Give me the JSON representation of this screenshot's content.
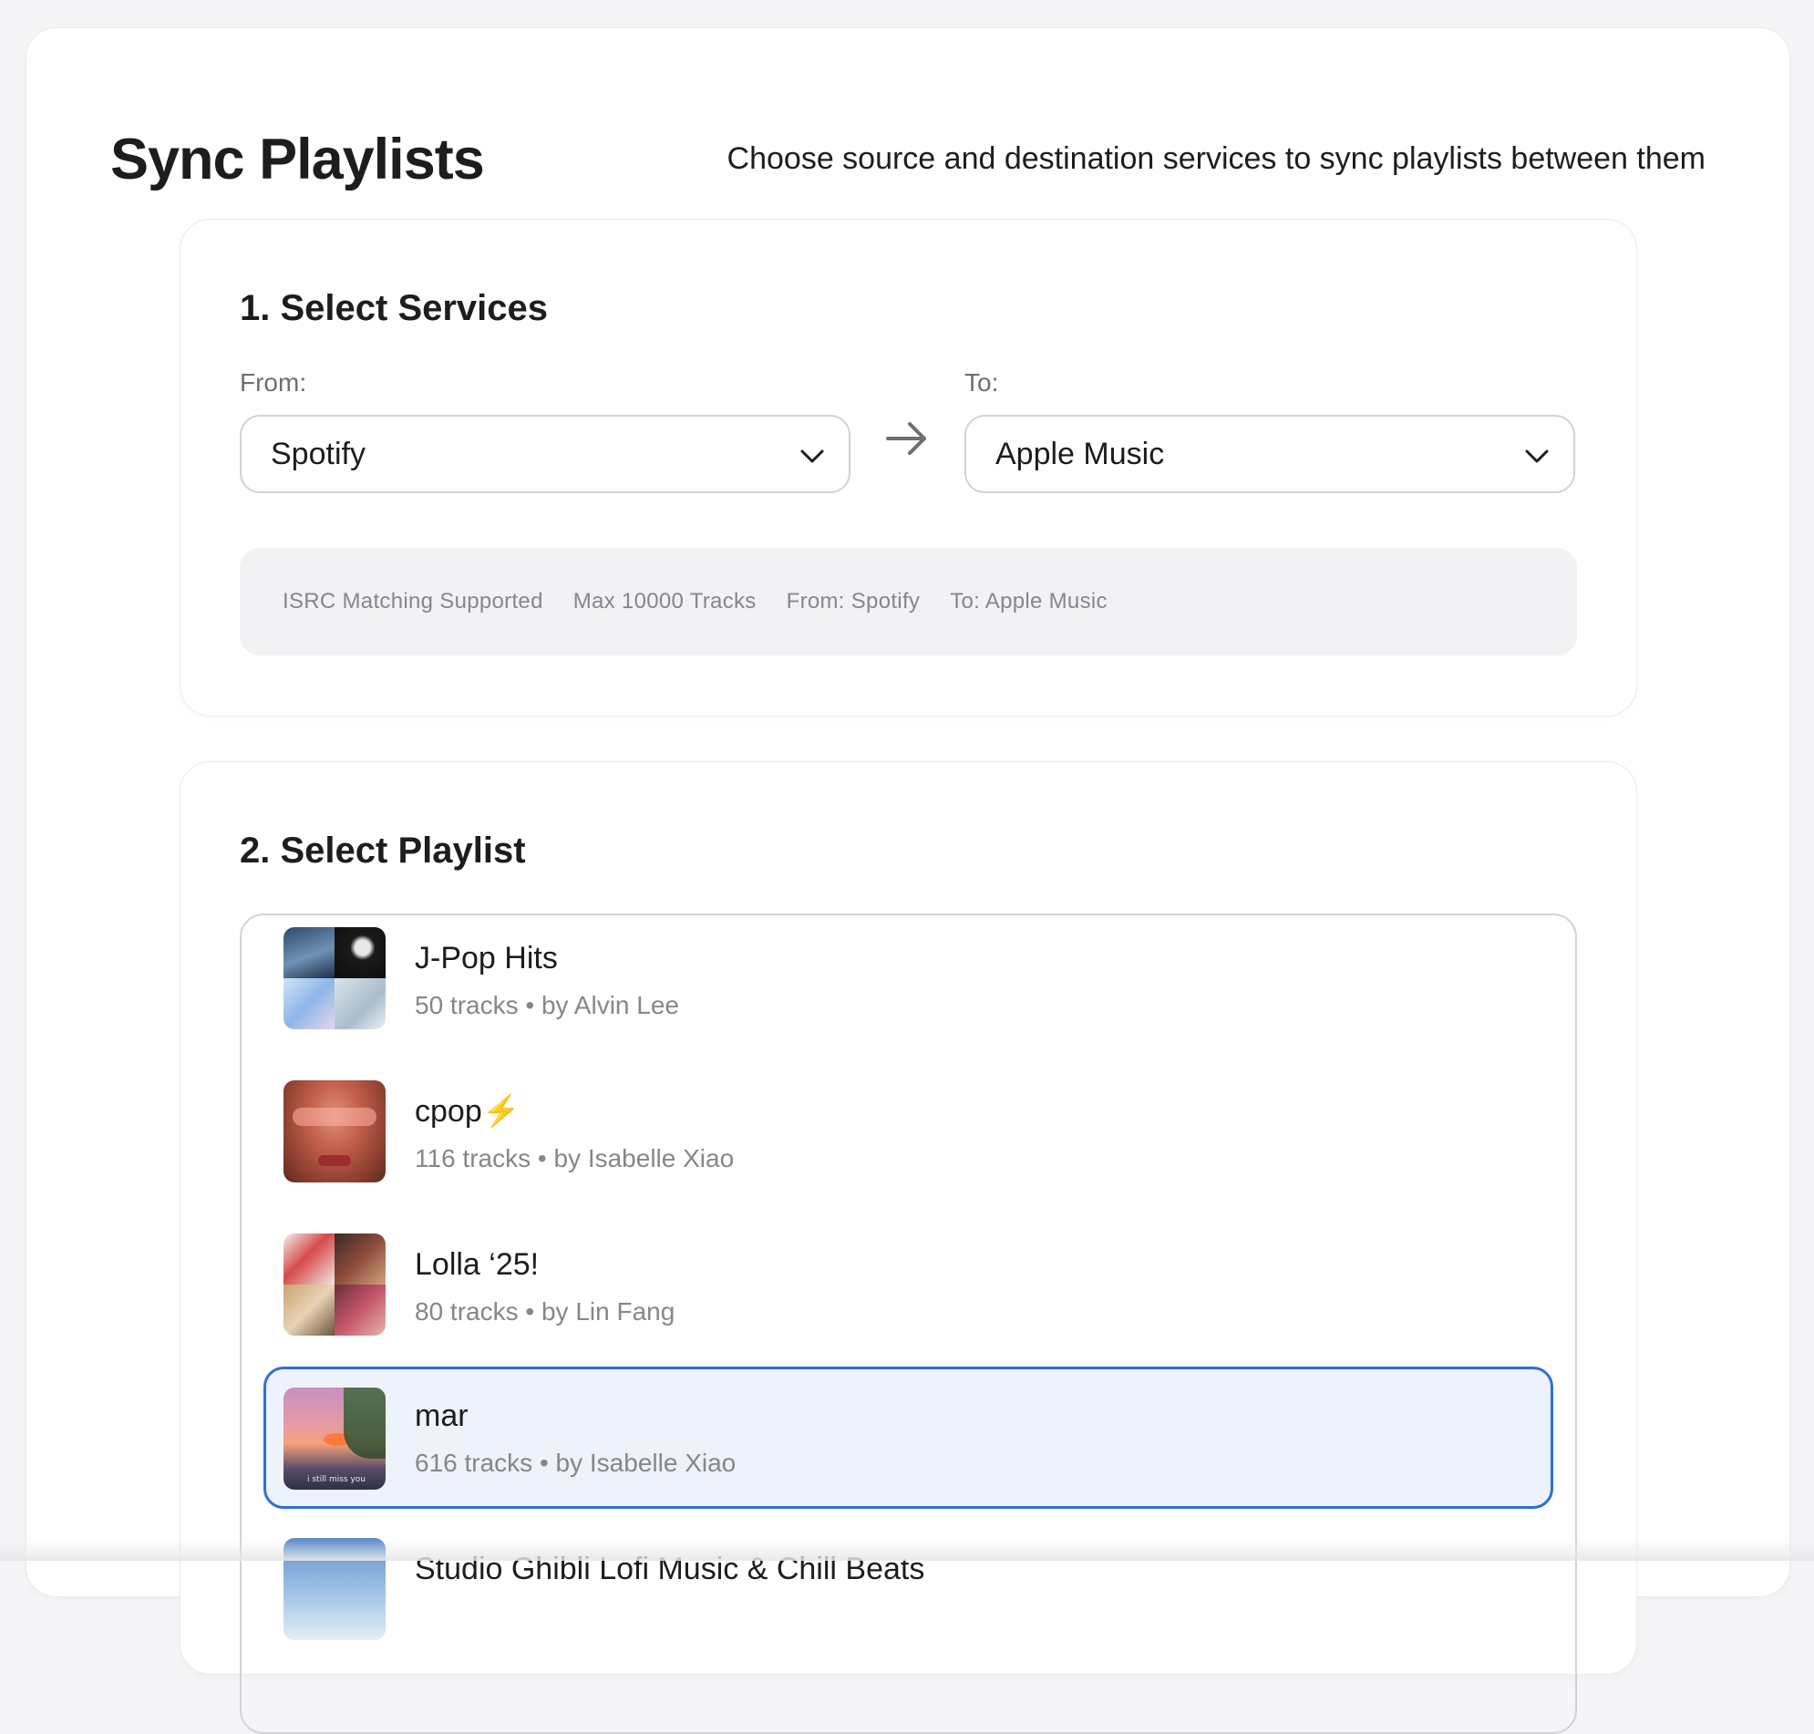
{
  "header": {
    "title": "Sync Playlists",
    "subtitle": "Choose source and destination services to sync playlists between them"
  },
  "services": {
    "heading": "1. Select Services",
    "from_label": "From:",
    "from_value": "Spotify",
    "to_label": "To:",
    "to_value": "Apple Music",
    "info_tags": [
      "ISRC Matching Supported",
      "Max 10000 Tracks",
      "From: Spotify",
      "To: Apple Music"
    ]
  },
  "playlists": {
    "heading": "2. Select Playlist",
    "items": [
      {
        "name": "J-Pop Hits",
        "suffix": "",
        "tracks": "50 tracks",
        "owner": "by Alvin Lee",
        "selected": false
      },
      {
        "name": "cpop",
        "suffix": "⚡",
        "tracks": "116 tracks",
        "owner": "by Isabelle Xiao",
        "selected": false
      },
      {
        "name": "Lolla ‘25!",
        "suffix": "",
        "tracks": "80 tracks",
        "owner": "by Lin Fang",
        "selected": false
      },
      {
        "name": "mar",
        "suffix": "",
        "tracks": "616 tracks",
        "owner": "by Isabelle Xiao",
        "selected": true
      },
      {
        "name": "Studio Ghibli Lofi Music & Chill Beats",
        "suffix": "",
        "tracks": "",
        "owner": "",
        "selected": false
      }
    ],
    "meta_separator": "•",
    "cover_caption_mar": "i still miss you"
  },
  "colors": {
    "accent": "#2f6fd6",
    "selected_bg": "#eef2fb",
    "muted_text": "#86868b",
    "bolt": "#f5b400"
  }
}
